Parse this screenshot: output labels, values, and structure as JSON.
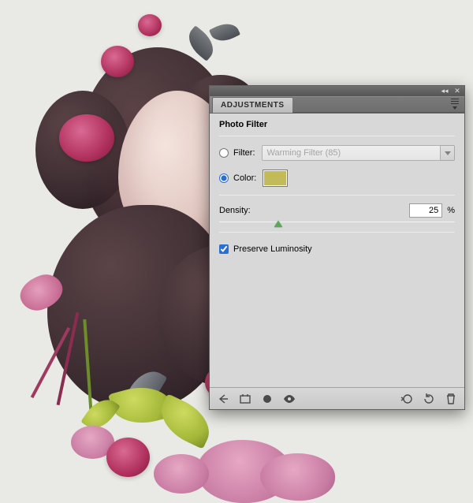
{
  "panel": {
    "tab_label": "ADJUSTMENTS",
    "title": "Photo Filter",
    "filter": {
      "label": "Filter:",
      "selected": "Warming Filter (85)",
      "checked": false
    },
    "color": {
      "label": "Color:",
      "checked": true,
      "swatch_hex": "#c3bb5b"
    },
    "density": {
      "label": "Density:",
      "value": "25",
      "percent_symbol": "%",
      "percent_numeric": 25
    },
    "preserve_luminosity": {
      "label": "Preserve Luminosity",
      "checked": true
    },
    "icons": {
      "collapse": "collapse-icon",
      "close": "close-icon",
      "menu": "panel-menu-icon",
      "back": "back-arrow-icon",
      "expand_view": "expand-view-icon",
      "clip_mask": "clip-to-layer-icon",
      "visibility": "visibility-eye-icon",
      "prev_state": "previous-state-icon",
      "reset": "reset-icon",
      "trash": "trash-icon"
    }
  }
}
